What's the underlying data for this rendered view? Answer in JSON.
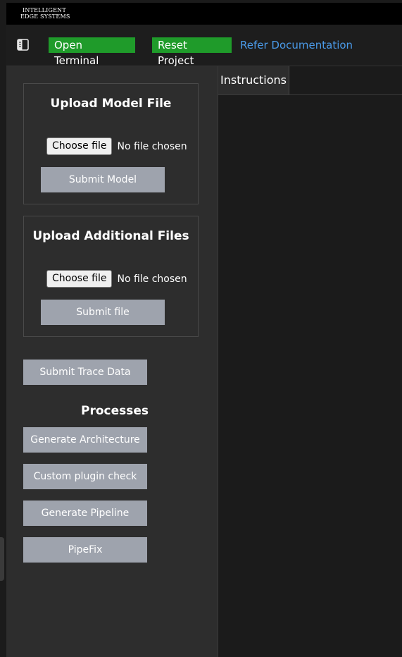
{
  "logo": {
    "line1": "INTELLIGENT",
    "line2": "EDGE SYSTEMS"
  },
  "nav": {
    "open_terminal": "Open Terminal",
    "reset_project": "Reset Project",
    "refer_documentation": "Refer Documentation"
  },
  "sidebar": {
    "upload_model": {
      "title": "Upload Model File",
      "choose_file": "Choose file",
      "status": "No file chosen",
      "submit": "Submit Model"
    },
    "upload_additional": {
      "title": "Upload Additional Files",
      "choose_file": "Choose file",
      "status": "No file chosen",
      "submit": "Submit file"
    },
    "submit_trace": "Submit Trace Data",
    "processes": {
      "heading": "Processes",
      "items": [
        "Generate Architecture",
        "Custom plugin check",
        "Generate Pipeline",
        "PipeFix"
      ]
    }
  },
  "main": {
    "tabs": [
      {
        "label": "Instructions"
      }
    ]
  },
  "colors": {
    "green_button": "#1f9b2a",
    "link": "#4a9ae8",
    "grey_button": "#9ea3ad",
    "sidebar_bg": "#2d2d2d",
    "page_bg": "#1b1b1b"
  },
  "icons": {
    "sidebar_toggle": "sidebar-toggle-icon"
  }
}
